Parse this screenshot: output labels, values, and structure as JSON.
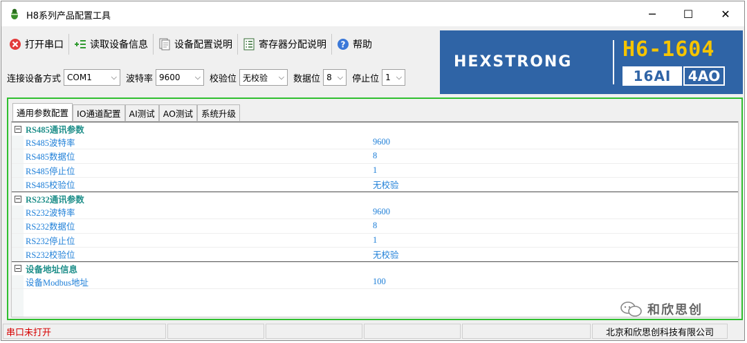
{
  "window": {
    "title": "H8系列产品配置工具",
    "minimize_glyph": "─",
    "maximize_glyph": "☐",
    "close_glyph": "✕"
  },
  "toolbar": {
    "open_port": "打开串口",
    "read_device": "读取设备信息",
    "device_config_doc": "设备配置说明",
    "register_doc": "寄存器分配说明",
    "help": "帮助"
  },
  "connection": {
    "method_label": "连接设备方式",
    "method_value": "COM1",
    "baud_label": "波特率",
    "baud_value": "9600",
    "parity_label": "校验位",
    "parity_value": "无校验",
    "databits_label": "数据位",
    "databits_value": "8",
    "stopbits_label": "停止位",
    "stopbits_value": "1"
  },
  "banner": {
    "brand": "HEXSTRONG",
    "model": "H6-1604",
    "spec_left": "16AI",
    "spec_right": "4AO",
    "colors": {
      "background": "#2f64a6",
      "model": "#f5c400"
    }
  },
  "tabs": [
    {
      "label": "通用参数配置",
      "active": true
    },
    {
      "label": "IO通道配置",
      "active": false
    },
    {
      "label": "AI测试",
      "active": false
    },
    {
      "label": "AO测试",
      "active": false
    },
    {
      "label": "系统升级",
      "active": false
    }
  ],
  "groups": [
    {
      "title": "RS485通讯参数",
      "rows": [
        {
          "name": "RS485波特率",
          "value": "9600"
        },
        {
          "name": "RS485数据位",
          "value": "8"
        },
        {
          "name": "RS485停止位",
          "value": "1"
        },
        {
          "name": "RS485校验位",
          "value": "无校验"
        }
      ]
    },
    {
      "title": "RS232通讯参数",
      "rows": [
        {
          "name": "RS232波特率",
          "value": "9600"
        },
        {
          "name": "RS232数据位",
          "value": "8"
        },
        {
          "name": "RS232停止位",
          "value": "1"
        },
        {
          "name": "RS232校验位",
          "value": "无校验"
        }
      ]
    },
    {
      "title": "设备地址信息",
      "rows": [
        {
          "name": "设备Modbus地址",
          "value": "100"
        }
      ]
    }
  ],
  "status": {
    "port_state": "串口未打开",
    "company": "北京和欣思创科技有限公司",
    "error_color": "#d60000"
  },
  "watermark": {
    "text": "和欣思创"
  }
}
